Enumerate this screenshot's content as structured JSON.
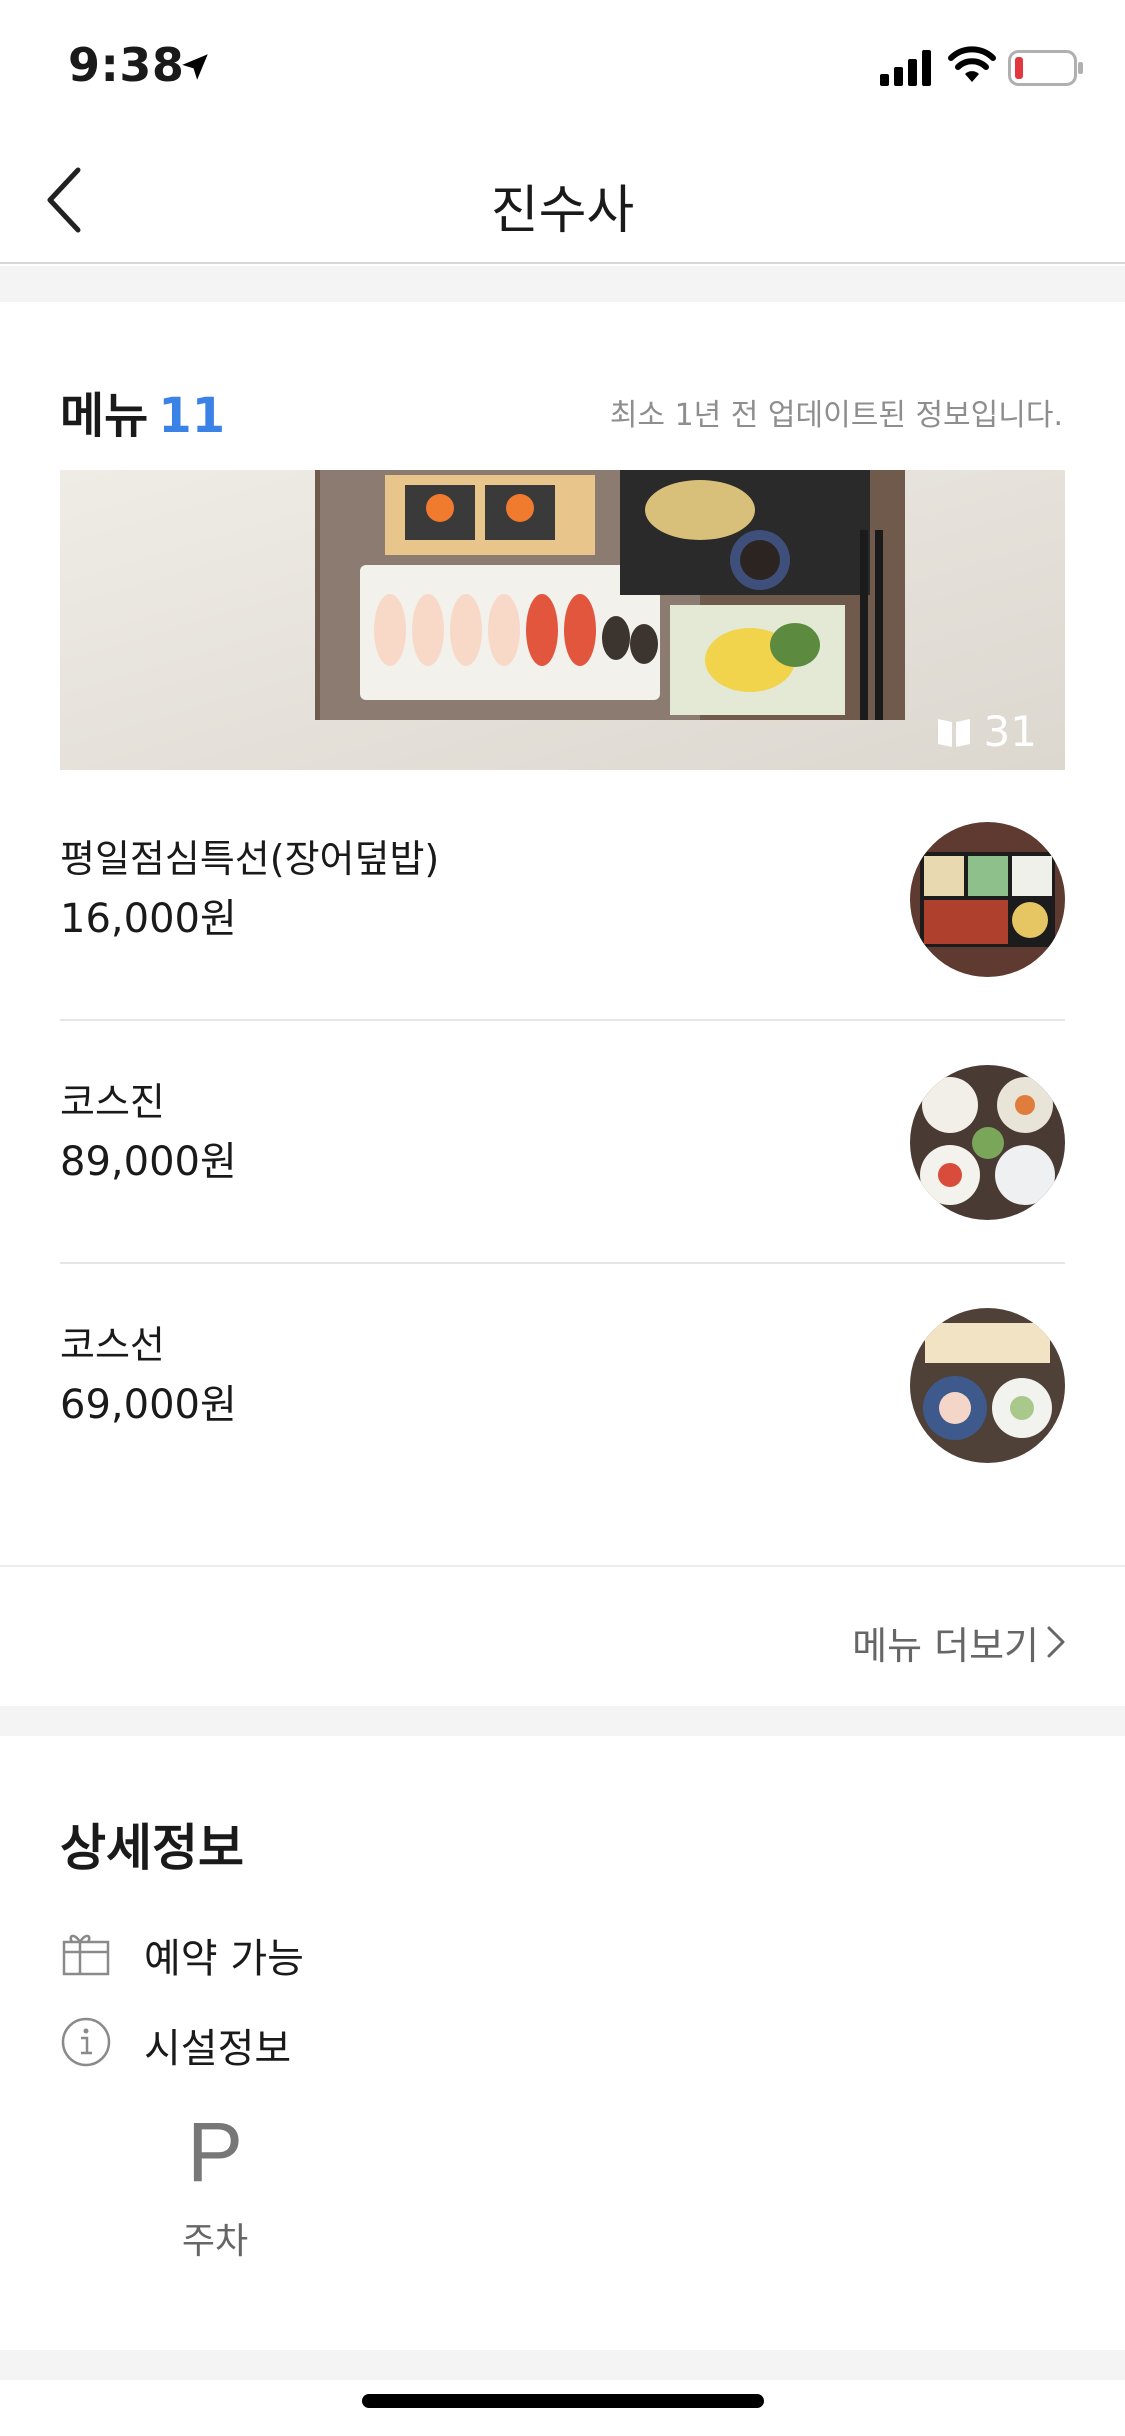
{
  "status_bar": {
    "time": "9:38"
  },
  "nav": {
    "title": "진수사"
  },
  "menu_section": {
    "title": "메뉴",
    "count": "11",
    "note": "최소 1년 전 업데이트된 정보입니다.",
    "photo_count": "31",
    "items": [
      {
        "name": "평일점심특선(장어덮밥)",
        "price": "16,000원"
      },
      {
        "name": "코스진",
        "price": "89,000원"
      },
      {
        "name": "코스선",
        "price": "69,000원"
      }
    ],
    "more_label": "메뉴 더보기"
  },
  "detail_section": {
    "title": "상세정보",
    "reservation_label": "예약 가능",
    "facility_label": "시설정보",
    "parking_letter": "P",
    "parking_label": "주차"
  },
  "colors": {
    "accent": "#3b82e6",
    "text": "#1a1a1a",
    "muted": "#8e8e8e",
    "divider": "#e6e6e6",
    "band": "#f4f4f4"
  }
}
